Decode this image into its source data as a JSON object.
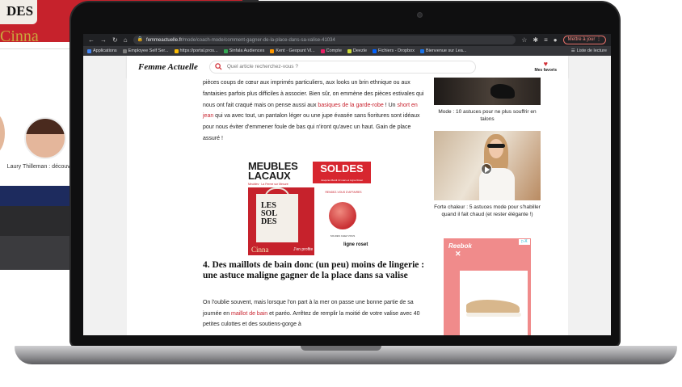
{
  "background_laptop": {
    "bag_text": "DES",
    "brand": "Cinna",
    "caption": "Laury Thilleman : découvrez ses"
  },
  "browser": {
    "back_icon": "arrow-left",
    "forward_icon": "arrow-right",
    "reload_icon": "reload",
    "home_icon": "home",
    "lock_icon": "lock",
    "url_host": "femmeactuelle.fr",
    "url_path": "/mode/coach-mode/comment-gagner-de-la-place-dans-sa-valise-41034",
    "update_label": "Mettre à jour",
    "bookmarks": [
      {
        "label": "Applications",
        "color": "#4285f4"
      },
      {
        "label": "Employee Self Ser...",
        "color": "#7c7c7c"
      },
      {
        "label": "https://portal.pros...",
        "color": "#fbbc04"
      },
      {
        "label": "Sinfala Audiences",
        "color": "#34a853"
      },
      {
        "label": "Kent · Geopunt Vl...",
        "color": "#ff9800"
      },
      {
        "label": "Compte",
        "color": "#e91e63"
      },
      {
        "label": "Deezle",
        "color": "#cddc39"
      },
      {
        "label": "Fichiers - Dropbox",
        "color": "#0061ff"
      },
      {
        "label": "Bienvenue sur Lea...",
        "color": "#1a73e8"
      }
    ],
    "reading_list": "Liste de lecture"
  },
  "site": {
    "logo": "Femme Actuelle",
    "search_placeholder": "Quel article recherchez-vous ?",
    "favs_label": "Mes favoris"
  },
  "article": {
    "para1_a": "pièces coups de cœur aux imprimés particuliers, aux looks un brin ethnique ou aux fantaisies parfois plus difficiles à associer. Bien sûr, on emmène des pièces estivales qui nous ont fait craqué mais on pense aussi aux ",
    "para1_link1": "basiques de la garde-robe",
    "para1_b": " ! Un ",
    "para1_link2": "short en jean",
    "para1_c": " qui va avec tout, un pantalon léger ou une jupe évasée sans fioritures sont idéaux pour nous éviter d'emmener foule de bas qui n'iront qu'avec un haut. Gain de place assuré !",
    "heading": "4. Des maillots de bain donc (un peu) moins de lingerie : une astuce maligne gagner de la place dans sa valise",
    "para2_a": "On l'oublie souvent, mais lorsque l'on part à la mer on passe une bonne partie de sa journée en ",
    "para2_link": "maillot de bain",
    "para2_b": " et paréo. Arrêtez de remplir la moitié de votre valise avec 40 petites culottes et des soutiens-gorge à"
  },
  "ad_meubles": {
    "logo": "MEUBLES\nLACAUX",
    "logo_sub": "Meubles · La Ferme sur Mesure",
    "soldes": "SOLDES",
    "soldes_sub": "Jusqu'au Mardi 13 mars et Ligne Roset",
    "tote_text": "LES\nSOL\nDES",
    "rdv": "RENDEZ-VOUS D'AFFAIRES",
    "brand1": "Cinna",
    "profite": "J'en profite",
    "shop_text": "SOLDES CHEZ VOUS",
    "brand2": "ligne roset"
  },
  "sidebar": {
    "caption1": "Mode : 10 astuces pour ne plus souffrir en talons",
    "caption2": "Forte chaleur : 5 astuces mode pour s'habiller quand il fait chaud (et rester élégante !)",
    "ad_brand": "Reebok",
    "ad_choice": "▷X"
  }
}
